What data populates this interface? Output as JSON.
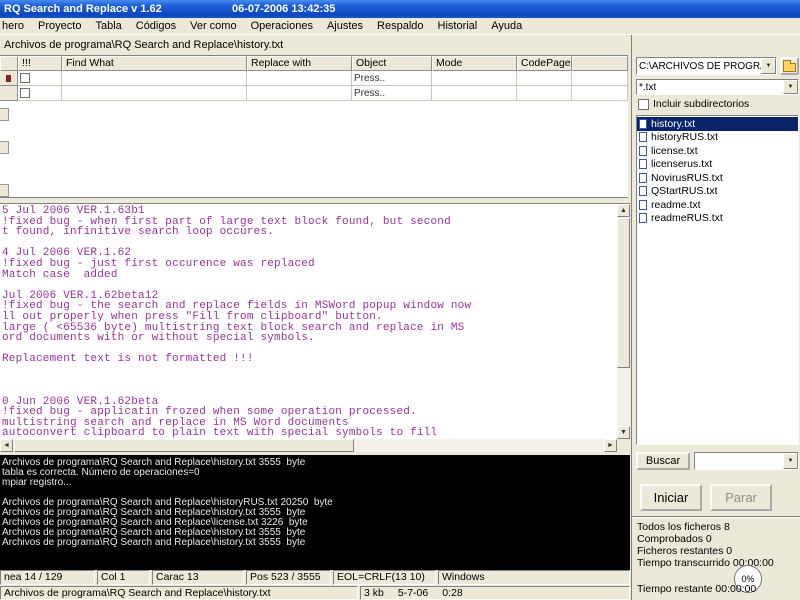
{
  "window": {
    "title": "RQ Search and Replace v 1.62",
    "datetime": "06-07-2006  13:42:35"
  },
  "menu_items": [
    "hero",
    "Proyecto",
    "Tabla",
    "Códigos",
    "Ver como",
    "Operaciones",
    "Ajustes",
    "Respaldo",
    "Historial",
    "Ayuda"
  ],
  "path_bar": "Archivos de programa\\RQ Search and Replace\\history.txt",
  "table": {
    "columns": [
      "!!!",
      "Find What",
      "Replace with",
      "Object",
      "Mode",
      "CodePage"
    ],
    "rows": [
      {
        "find": "",
        "replace": "",
        "object": "Press..",
        "mode": "",
        "codepage": ""
      },
      {
        "find": "",
        "replace": "",
        "object": "Press..",
        "mode": "",
        "codepage": ""
      }
    ]
  },
  "editor": {
    "lines": [
      "5 Jul 2006 VER.1.63b1",
      "!fixed bug - when first part of large text block found, but second",
      "t found, infinitive search loop occures.",
      "",
      "4 Jul 2006 VER.1.62",
      "!fixed bug - just first occurence was replaced",
      "Match case  added",
      "",
      "Jul 2006 VER.1.62beta12",
      "!fixed bug - the search and replace fields in MSWord popup window now",
      "ll out properly when press \"Fill from clipboard\" button.",
      "large ( <65536 byte) multistring text block search and replace in MS",
      "ord documents with or without special symbols.",
      "",
      "Replacement text is not formatted !!!",
      "",
      "",
      "",
      "0 Jun 2006 VER.1.62beta",
      "!fixed bug - applicatin frozed when some operation processed.",
      "multistring search and replace in MS Word documents",
      "autoconvert clipboard to plain text with special symbols to fill"
    ]
  },
  "log": {
    "lines": [
      "Archivos de programa\\RQ Search and Replace\\history.txt 3555  byte",
      "tabla es correcta. Número de operaciones=0",
      "mpiar registro...",
      "",
      "Archivos de programa\\RQ Search and Replace\\historyRUS.txt 20250  byte",
      "Archivos de programa\\RQ Search and Replace\\history.txt 3555  byte",
      "Archivos de programa\\RQ Search and Replace\\license.txt 3226  byte",
      "Archivos de programa\\RQ Search and Replace\\history.txt 3555  byte",
      "Archivos de programa\\RQ Search and Replace\\history.txt 3555  byte"
    ]
  },
  "right_panel": {
    "dir_combo": "C:\\ARCHIVOS DE PROGRAMA\\RQ",
    "mask_combo": "*.txt",
    "include_subdirs": "Incluir subdirectorios",
    "files": [
      {
        "name": "history.txt",
        "selected": true
      },
      {
        "name": "historyRUS.txt"
      },
      {
        "name": "license.txt"
      },
      {
        "name": "licenserus.txt"
      },
      {
        "name": "NovirusRUS.txt"
      },
      {
        "name": "QStartRUS.txt"
      },
      {
        "name": "readme.txt"
      },
      {
        "name": "readmeRUS.txt"
      }
    ],
    "search_button": "Buscar",
    "start_button": "Iniciar",
    "stop_button": "Parar",
    "stats": [
      "Todos los ficheros 8",
      "Comprobados 0",
      "Ficheros restantes 0",
      "Tiempo transcurrido 00:00:00"
    ],
    "progress": "0%",
    "time_remaining": "Tiempo restante 00:00:00"
  },
  "status_bar": [
    "nea 14 / 129",
    "Col 1",
    "Carac 13",
    "Pos 523 / 3555",
    "EOL=CRLF(13 10)",
    "Windows"
  ],
  "file_bar": {
    "path": "Archivos de programa\\RQ Search and Replace\\history.txt",
    "size": "3 kb",
    "date": "5-7-06",
    "time": "0:28"
  },
  "icons": {
    "up": "▲",
    "down": "▼",
    "left": "◄",
    "right": "►"
  },
  "colors": {
    "titlebar_blue": "#1c5fd8",
    "chrome": "#ECE9D8",
    "selection_navy": "#0A246A",
    "editor_text": "#993399",
    "log_background": "#000000"
  }
}
